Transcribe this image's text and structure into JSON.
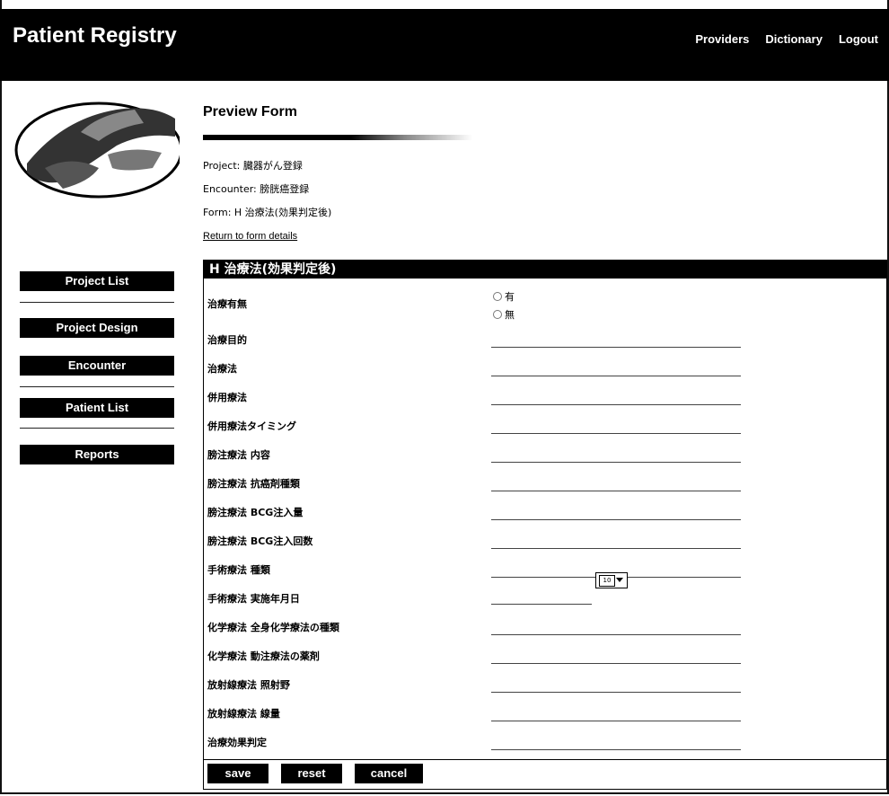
{
  "header": {
    "app_title": "Patient Registry",
    "nav": [
      "Providers",
      "Dictionary",
      "Logout"
    ]
  },
  "sidebar": {
    "items": [
      {
        "label": "Project List"
      },
      {
        "label": "Project Design"
      },
      {
        "label": "Encounter"
      },
      {
        "label": "Patient List"
      },
      {
        "label": "Reports"
      }
    ]
  },
  "main": {
    "title": "Preview Form",
    "project": "Project: 臓器がん登録",
    "encounter": "Encounter: 膀胱癌登録",
    "form": "Form: H  治療法(効果判定後)",
    "return_link": "Return to form details"
  },
  "form": {
    "header": "H  治療法(効果判定後)",
    "fields": [
      {
        "label": "治療有無"
      },
      {
        "label": "治療目的"
      },
      {
        "label": "治療法"
      },
      {
        "label": "併用療法"
      },
      {
        "label": "併用療法タイミング"
      },
      {
        "label": "膀注療法  内容"
      },
      {
        "label": "膀注療法  抗癌剤種類"
      },
      {
        "label": "膀注療法  BCG注入量"
      },
      {
        "label": "膀注療法  BCG注入回数"
      },
      {
        "label": "手術療法  種類"
      },
      {
        "label": "手術療法  実施年月日"
      },
      {
        "label": "化学療法  全身化学療法の種類"
      },
      {
        "label": "化学療法  動注療法の薬剤"
      },
      {
        "label": "放射線療法  照射野"
      },
      {
        "label": "放射線療法  線量"
      },
      {
        "label": "治療効果判定"
      }
    ],
    "radio_options": [
      "有",
      "無"
    ],
    "buttons": {
      "save": "save",
      "reset": "reset",
      "cancel": "cancel"
    }
  }
}
